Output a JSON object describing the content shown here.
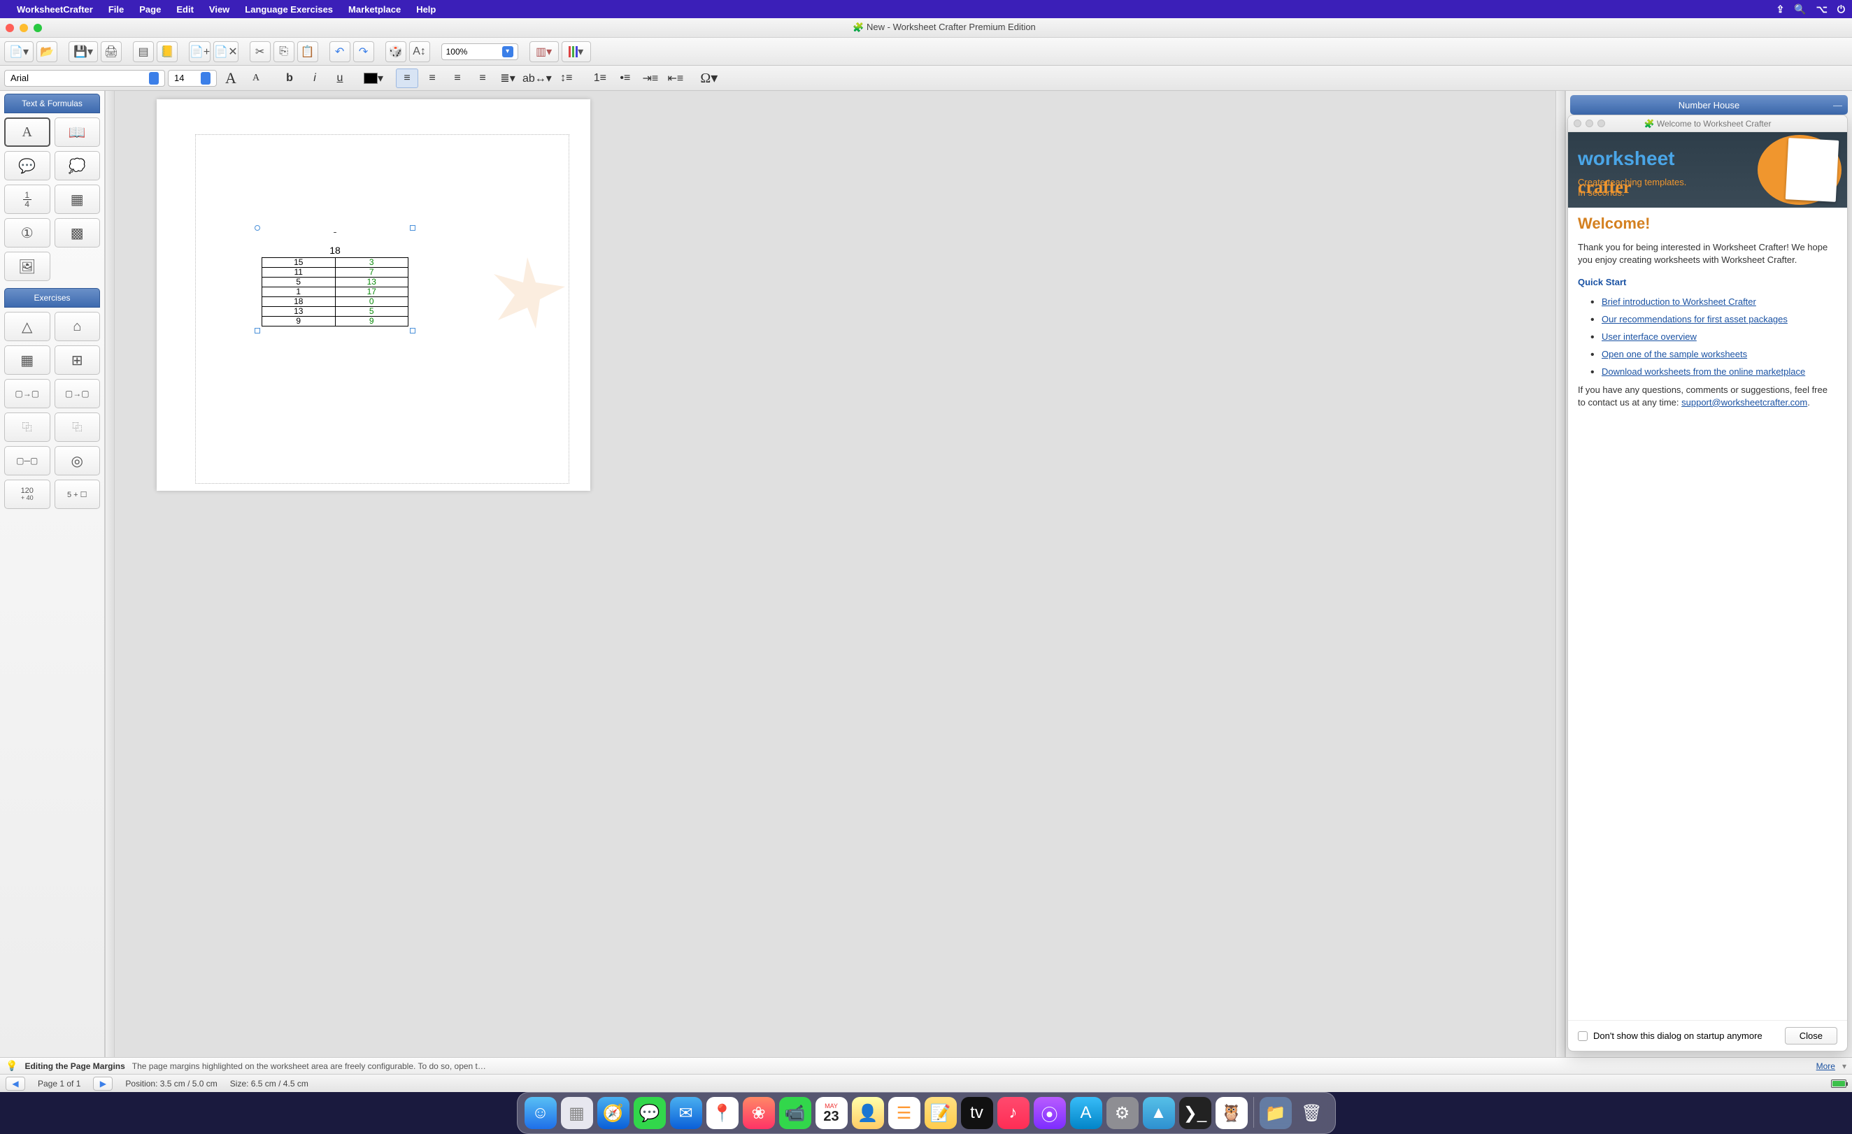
{
  "menubar": {
    "app": "WorksheetCrafter",
    "items": [
      "File",
      "Page",
      "Edit",
      "View",
      "Language Exercises",
      "Marketplace",
      "Help"
    ]
  },
  "window_title": "New  - Worksheet Crafter Premium Edition",
  "toolbar": {
    "zoom": "100%"
  },
  "format": {
    "font": "Arial",
    "size": "14"
  },
  "left_panels": {
    "text_formulas": "Text & Formulas",
    "exercises": "Exercises"
  },
  "number_house": {
    "top": "18",
    "rows": [
      {
        "l": "15",
        "r": "3"
      },
      {
        "l": "11",
        "r": "7"
      },
      {
        "l": "5",
        "r": "13"
      },
      {
        "l": "1",
        "r": "17"
      },
      {
        "l": "18",
        "r": "0"
      },
      {
        "l": "13",
        "r": "5"
      },
      {
        "l": "9",
        "r": "9"
      }
    ]
  },
  "left_tail": {
    "a": "120",
    "b": "40",
    "c": "5 + ☐"
  },
  "right_panel": {
    "title": "Number House"
  },
  "welcome": {
    "title": "Welcome to Worksheet Crafter",
    "banner_sub1": "Create teaching templates.",
    "banner_sub2": "In seconds.",
    "heading": "Welcome!",
    "intro": "Thank you for being interested in Worksheet Crafter! We hope you enjoy creating worksheets with Worksheet Crafter.",
    "quick_start": "Quick Start",
    "links": [
      "Brief introduction to Worksheet Crafter",
      "Our recommendations for first asset packages",
      "User interface overview",
      "Open one of the sample worksheets",
      "Download worksheets from the online marketplace"
    ],
    "contact_pre": "If you have any questions, comments or suggestions, feel free to contact us at any time: ",
    "contact_link": "support@worksheetcrafter.com",
    "dont_show": "Don't show this dialog on startup anymore",
    "close": "Close"
  },
  "hint": {
    "title": "Editing the Page Margins",
    "text": "The page margins highlighted on the worksheet area are freely configurable. To do so, open t…",
    "more": "More"
  },
  "status": {
    "page": "Page 1 of 1",
    "position": "Position: 3.5 cm / 5.0 cm",
    "size": "Size: 6.5 cm / 4.5 cm"
  },
  "dock_date": {
    "month": "MAY",
    "day": "23"
  }
}
